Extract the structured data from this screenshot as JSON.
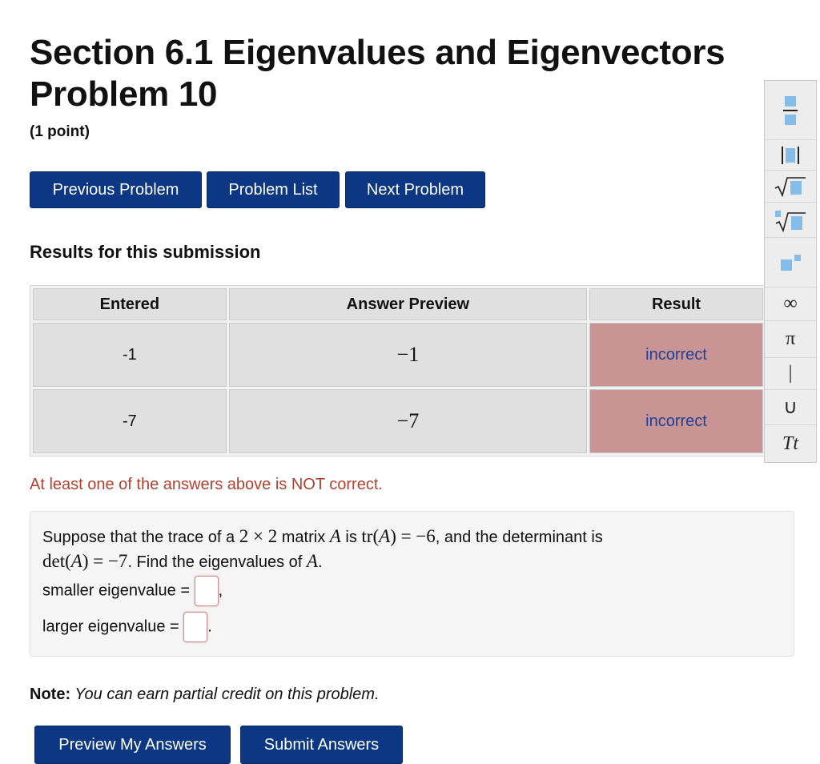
{
  "page": {
    "title_line1": "Section 6.1 Eigenvalues and Eigenvectors",
    "title_line2": "Problem 10",
    "points": "(1 point)"
  },
  "nav": {
    "previous": "Previous Problem",
    "list": "Problem List",
    "next": "Next Problem"
  },
  "results": {
    "heading": "Results for this submission",
    "columns": [
      "Entered",
      "Answer Preview",
      "Result"
    ],
    "rows": [
      {
        "entered": "-1",
        "preview": "−1",
        "result": "incorrect"
      },
      {
        "entered": "-7",
        "preview": "−7",
        "result": "incorrect"
      }
    ],
    "message": "At least one of the answers above is NOT correct."
  },
  "problem": {
    "t1": "Suppose that the trace of a ",
    "m1": "2 × 2",
    "t2": " matrix ",
    "m2": "A",
    "t3": " is ",
    "m3": "tr(",
    "m4": "A",
    "m5": ") = −6",
    "t4": ", and the determinant is",
    "m6": "det(",
    "m7": "A",
    "m8": ") = −7",
    "t5": ". Find the eigenvalues of ",
    "m9": "A",
    "t6": ".",
    "smaller_label": "smaller eigenvalue = ",
    "smaller_suffix": ",",
    "larger_label": "larger eigenvalue = ",
    "larger_suffix": ".",
    "smaller_value": "",
    "larger_value": ""
  },
  "note": {
    "label": "Note:",
    "text": " You can earn partial credit on this problem."
  },
  "actions": {
    "preview": "Preview My Answers",
    "submit": "Submit Answers"
  },
  "toolbar": {
    "infinity": "∞",
    "pi": "π",
    "bar": "|",
    "union": "∪",
    "text_mode": "Tt",
    "accent": "#85bde8"
  },
  "colors": {
    "button": "#0c3785",
    "incorrect_bg": "#c99594",
    "incorrect_text": "#1e3f9a",
    "message": "#b3412f"
  }
}
